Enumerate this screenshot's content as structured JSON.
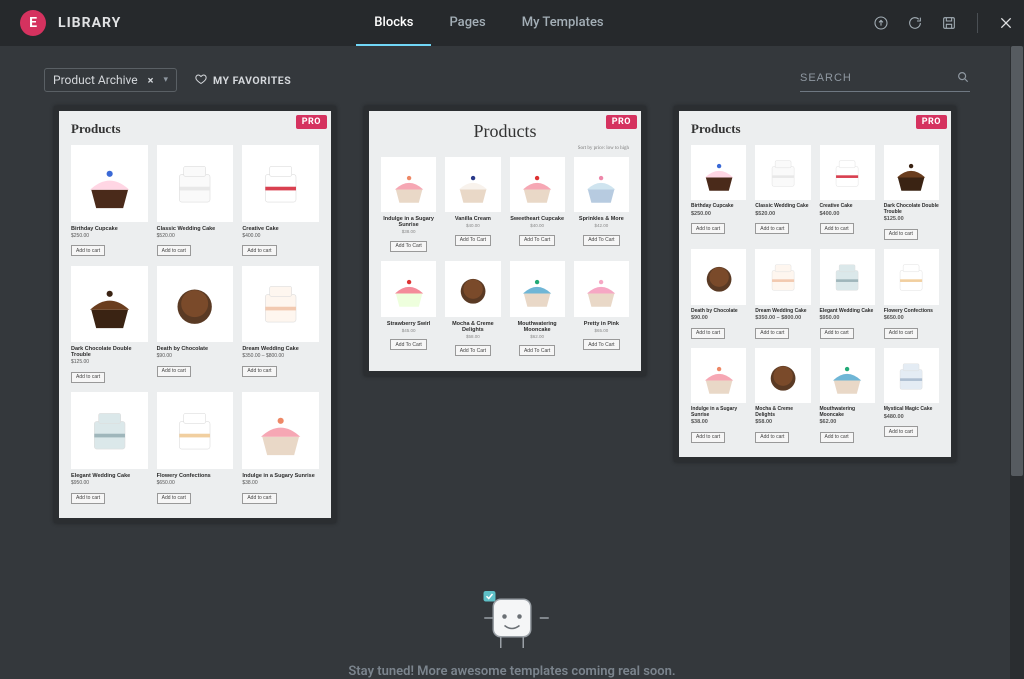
{
  "header": {
    "title": "LIBRARY",
    "tabs": [
      {
        "label": "Blocks",
        "active": true
      },
      {
        "label": "Pages",
        "active": false
      },
      {
        "label": "My Templates",
        "active": false
      }
    ]
  },
  "subhead": {
    "filter_label": "Product Archive",
    "favorites_label": "MY FAVORITES",
    "search_placeholder": "SEARCH"
  },
  "badges": {
    "pro": "PRO"
  },
  "buttons": {
    "add_to_cart": "Add To Cart",
    "add_to_cart_short": "Add to cart"
  },
  "cardA": {
    "title": "Products",
    "items": [
      {
        "name": "Birthday Cupcake",
        "price": "$250.00",
        "swatch": "birthday"
      },
      {
        "name": "Classic Wedding Cake",
        "price": "$520.00",
        "swatch": "whitecake"
      },
      {
        "name": "Creative Cake",
        "price": "$400.00",
        "swatch": "bowtie"
      },
      {
        "name": "Dark Chocolate Double Trouble",
        "price": "$125.00",
        "swatch": "darkchoc"
      },
      {
        "name": "Death by Chocolate",
        "price": "$90.00",
        "swatch": "chocball"
      },
      {
        "name": "Dream Wedding Cake",
        "price": "$350.00 – $800.00",
        "swatch": "pastelcake"
      },
      {
        "name": "Elegant Wedding Cake",
        "price": "$950.00",
        "swatch": "bluecake"
      },
      {
        "name": "Flowery Confections",
        "price": "$650.00",
        "swatch": "flowercake"
      },
      {
        "name": "Indulge in a Sugary Sunrise",
        "price": "$38.00",
        "swatch": "pinkcup"
      }
    ]
  },
  "cardB": {
    "title": "Products",
    "sort_line": "Sort by price: low to high",
    "items": [
      {
        "name": "Indulge in a Sugary Sunrise",
        "meta": "$38.00",
        "swatch": "pinkcup"
      },
      {
        "name": "Vanilla Cream",
        "meta": "$40.00",
        "swatch": "berrycup"
      },
      {
        "name": "Sweetheart Cupcake",
        "meta": "$40.00",
        "swatch": "heartcup"
      },
      {
        "name": "Sprinkles & More",
        "meta": "$42.00",
        "swatch": "bluecup"
      },
      {
        "name": "Strawberry Swirl",
        "meta": "$45.00",
        "swatch": "strawcup"
      },
      {
        "name": "Mocha & Creme Delights",
        "meta": "$58.00",
        "swatch": "mocha"
      },
      {
        "name": "Mouthwatering Mooncake",
        "meta": "$62.00",
        "swatch": "bluefr"
      },
      {
        "name": "Pretty in Pink",
        "meta": "$65.00",
        "swatch": "pinkswirl"
      }
    ]
  },
  "cardC": {
    "title": "Products",
    "items": [
      {
        "name": "Birthday Cupcake",
        "price": "$250.00",
        "swatch": "birthday"
      },
      {
        "name": "Classic Wedding Cake",
        "price": "$520.00",
        "swatch": "whitecake"
      },
      {
        "name": "Creative Cake",
        "price": "$400.00",
        "swatch": "bowtie"
      },
      {
        "name": "Dark Chocolate Double Trouble",
        "price": "$125.00",
        "swatch": "darkchoc"
      },
      {
        "name": "Death by Chocolate",
        "price": "$90.00",
        "swatch": "chocball"
      },
      {
        "name": "Dream Wedding Cake",
        "price": "$350.00 – $800.00",
        "swatch": "pastelcake"
      },
      {
        "name": "Elegant Wedding Cake",
        "price": "$950.00",
        "swatch": "bluecake"
      },
      {
        "name": "Flowery Confections",
        "price": "$650.00",
        "swatch": "flowercake"
      },
      {
        "name": "Indulge in a Sugary Sunrise",
        "price": "$38.00",
        "swatch": "pinkcup"
      },
      {
        "name": "Mocha & Creme Delights",
        "price": "$58.00",
        "swatch": "mocha"
      },
      {
        "name": "Mouthwatering Mooncake",
        "price": "$62.00",
        "swatch": "bluefr"
      },
      {
        "name": "Mystical Magic Cake",
        "price": "$480.00",
        "swatch": "mystcake"
      }
    ]
  },
  "footer": {
    "message": "Stay tuned! More awesome templates coming real soon."
  }
}
